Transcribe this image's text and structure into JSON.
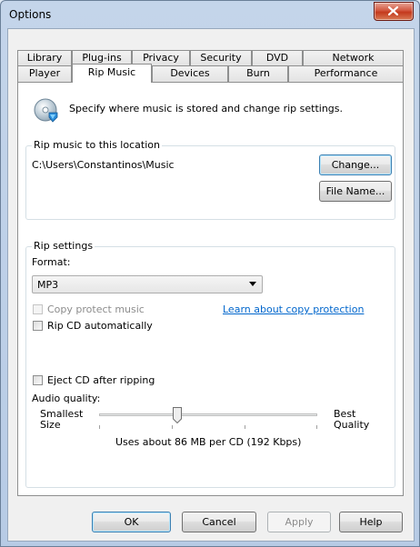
{
  "window": {
    "title": "Options"
  },
  "tabs_row1": [
    "Library",
    "Plug-ins",
    "Privacy",
    "Security",
    "DVD",
    "Network"
  ],
  "tabs_row2": [
    "Player",
    "Rip Music",
    "Devices",
    "Burn",
    "Performance"
  ],
  "selected_tab": "Rip Music",
  "header": {
    "description": "Specify where music is stored and change rip settings."
  },
  "location": {
    "group_label": "Rip music to this location",
    "path": "C:\\Users\\Constantinos\\Music",
    "change_label": "Change...",
    "filename_label": "File Name..."
  },
  "rip_settings": {
    "group_label": "Rip settings",
    "format_label": "Format:",
    "format_value": "MP3",
    "copy_protect_label": "Copy protect music",
    "copy_protect_checked": false,
    "learn_link": "Learn about copy protection",
    "rip_auto_label": "Rip CD automatically",
    "rip_auto_checked": false,
    "eject_label": "Eject CD after ripping",
    "eject_checked": false,
    "audio_quality_label": "Audio quality:",
    "smallest_label": "Smallest",
    "size_label": "Size",
    "best_label": "Best",
    "quality_label": "Quality",
    "quality_level": 0.36,
    "usage_text": "Uses about 86 MB per CD (192 Kbps)"
  },
  "buttons": {
    "ok": "OK",
    "cancel": "Cancel",
    "apply": "Apply",
    "help": "Help"
  },
  "colors": {
    "link": "#0066cc",
    "close_button": "#c4391c",
    "titlebar": "#c4d5ea"
  }
}
